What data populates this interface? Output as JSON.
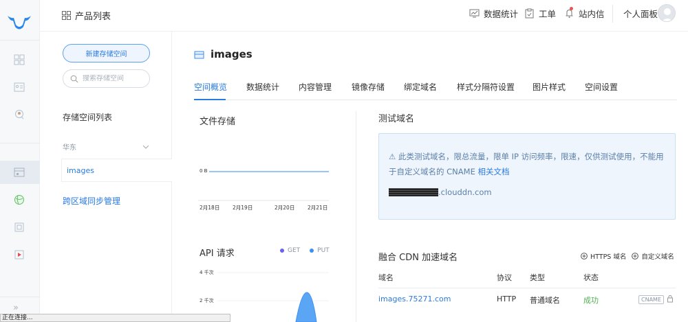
{
  "topbar": {
    "product_list": "产品列表",
    "nav": [
      {
        "label": "数据统计",
        "icon": "chart-monitor-icon"
      },
      {
        "label": "工单",
        "icon": "clipboard-icon"
      },
      {
        "label": "站内信",
        "icon": "bell-icon"
      }
    ],
    "personal_panel": "个人面板"
  },
  "bucket_sidebar": {
    "new_bucket_button": "新建存储空间",
    "search_placeholder": "搜索存储空间",
    "list_title": "存储空间列表",
    "region": "华东",
    "buckets": [
      "images"
    ],
    "cross_region_sync": "跨区域同步管理"
  },
  "main": {
    "bucket_name": "images",
    "tabs": [
      "空间概览",
      "数据统计",
      "内容管理",
      "镜像存储",
      "绑定域名",
      "样式分隔符设置",
      "图片样式",
      "空间设置"
    ],
    "active_tab": "空间概览",
    "file_storage": {
      "title": "文件存储",
      "ylabel": "0 B",
      "dates": [
        "2月18日",
        "2月19日",
        "2月20日",
        "2月21日"
      ]
    },
    "api": {
      "title": "API 请求",
      "legend": [
        {
          "name": "GET",
          "color": "#6b63e8"
        },
        {
          "name": "PUT",
          "color": "#3f8ff0"
        }
      ],
      "yticks": [
        "4 千次",
        "2 千次"
      ]
    },
    "test_domain": {
      "title": "测试域名",
      "warning_text": "此类测试域名，限总流量，限单 IP 访问频率，限速，仅供测试使用，不能用于自定义域名的 CNAME",
      "doc_link": "相关文档",
      "domain_suffix": ".clouddn.com"
    },
    "cdn": {
      "title": "融合 CDN 加速域名",
      "https_action": "HTTPS 域名",
      "custom_action": "自定义域名",
      "columns": [
        "域名",
        "协议",
        "类型",
        "状态"
      ],
      "rows": [
        {
          "domain": "images.75271.com",
          "protocol": "HTTP",
          "type": "普通域名",
          "status": "成功",
          "cname": "CNAME"
        }
      ]
    }
  },
  "colors": {
    "accent": "#2a7ae2",
    "success": "#52b152"
  },
  "status_bar": "正在连接..."
}
